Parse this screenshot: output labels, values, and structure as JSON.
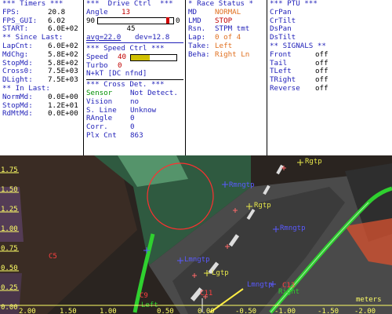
{
  "timers": {
    "header": "*** Timers ***",
    "fps_k": "FPS:",
    "fps_v": "20.8",
    "fpsgui_k": "FPS_GUI:",
    "fpsgui_v": "6.02",
    "start_k": "START:",
    "start_v": "6.0E+02",
    "since_hdr": "** Since Last:",
    "since": [
      {
        "k": "LapCnt:",
        "v": "6.0E+02"
      },
      {
        "k": "MdChg:",
        "v": "5.8E+02"
      },
      {
        "k": "StopMd:",
        "v": "5.8E+02"
      },
      {
        "k": "Cross0:",
        "v": "7.5E+03"
      },
      {
        "k": "DLight:",
        "v": "7.5E+03"
      }
    ],
    "inlast_hdr": "** In Last:",
    "inlast": [
      {
        "k": "NormMd:",
        "v": "0.0E+00"
      },
      {
        "k": "StopMd:",
        "v": "1.2E+01"
      },
      {
        "k": "RdMtMd:",
        "v": "0.0E+00"
      }
    ]
  },
  "drive": {
    "header": "***  Drive Ctrl  ***",
    "angle_k": "Angle",
    "angle_v": "13",
    "range_min": "90",
    "range_max": "0",
    "center": "45",
    "avg": "avg=22.0",
    "dev": "dev=12.8",
    "angle_fraction": 0.91,
    "speed_hdr": "*** Speed Ctrl ***",
    "speed_k": "Speed",
    "speed_v": "40",
    "speed_fraction": 0.42,
    "turbo_k": "Turbo",
    "turbo_v": "0",
    "nkt": "N+kT [DC nfnd]",
    "cross_hdr": "*** Cross Det. ***",
    "cross": [
      {
        "k": "Sensor",
        "v": "Not Detect."
      },
      {
        "k": "Vision",
        "v": "no"
      },
      {
        "k": "S. Line",
        "v": "Unknow"
      },
      {
        "k": "RAngle",
        "v": "0"
      },
      {
        "k": "Corr.",
        "v": "0"
      },
      {
        "k": "Plx Cnt",
        "v": "863"
      }
    ]
  },
  "race": {
    "header": "* Race Status *",
    "rows": [
      {
        "k": "MD",
        "v": "NORMAL"
      },
      {
        "k": "LMD",
        "v": "STOP"
      },
      {
        "k": "Rsn.",
        "v": "STPM tmt"
      },
      {
        "k": "Lap:",
        "v": "0 of 4"
      },
      {
        "k": "Take:",
        "v": "Left"
      },
      {
        "k": "Beha:",
        "v": "Right Ln"
      }
    ]
  },
  "ptu": {
    "header": "*** PTU ***",
    "items": [
      "CrPan",
      "CrTilt",
      "DsPan",
      "DsTilt"
    ],
    "signals_hdr": "** SIGNALS **",
    "signals": [
      {
        "k": "Front",
        "v": "off"
      },
      {
        "k": "Tail",
        "v": "off"
      },
      {
        "k": "TLeft",
        "v": "off"
      },
      {
        "k": "TRight",
        "v": "off"
      },
      {
        "k": "Reverse",
        "v": "off"
      }
    ]
  },
  "camera": {
    "y_ticks": [
      "1.75",
      "1.50",
      "1.25",
      "1.00",
      "0.75",
      "0.50",
      "0.25",
      "0.00"
    ],
    "x_ticks": [
      "2.00",
      "1.50",
      "1.00",
      "0.50",
      "0.00",
      "-0.50",
      "-1.00",
      "-1.50",
      "-2.00"
    ],
    "x_unit": "meters",
    "labels": {
      "rgtp_far": "Rgtp",
      "rmngtp": "Rmngtp",
      "rgtp": "Rgtp",
      "rmngtp2": "Rmngtp",
      "lmngtp": "Lmngtp",
      "lgtp": "Lgtp",
      "lmngtp2": "Lmngtp",
      "c5": "C5",
      "c9": "C9",
      "c11": "C11",
      "c13": "C13",
      "left": "Left",
      "right": "Right"
    },
    "colors": {
      "green_line": "#2fd02f",
      "label_blue": "#5a5aff",
      "label_yellow": "#e8e84a",
      "marker_red": "#ff4040",
      "tick_yellow": "#ffff66"
    }
  }
}
